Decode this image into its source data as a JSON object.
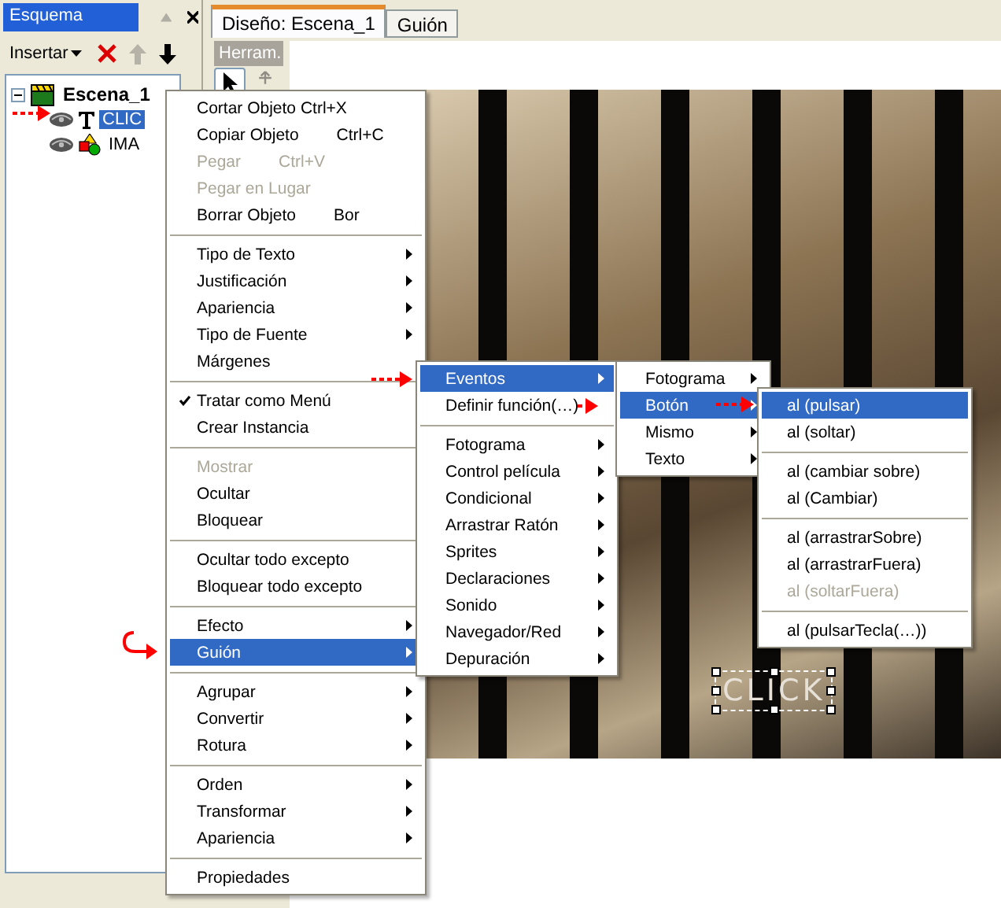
{
  "outline_panel": {
    "title": "Esquema",
    "toolbar": {
      "insert_label": "Insertar",
      "move_up_disabled": true
    },
    "tree": [
      {
        "label": "Escena_1",
        "expanded": true,
        "children": [
          {
            "label": "CLIC",
            "kind": "text",
            "selected": true
          },
          {
            "label": "IMA",
            "kind": "image",
            "selected": false
          }
        ]
      }
    ]
  },
  "tabs": [
    {
      "label": "Diseño: Escena_1",
      "selected": true
    },
    {
      "label": "Guión",
      "selected": false
    }
  ],
  "tools": {
    "label": "Herram."
  },
  "canvas": {
    "text_object": "CLICK",
    "text_selected": true
  },
  "context_menu": [
    {
      "kind": "item",
      "label": "Cortar Objeto Ctrl+X",
      "submenu": false,
      "disabled": false,
      "checked": false,
      "selected": false
    },
    {
      "kind": "item",
      "label": "Copiar Objeto",
      "shortcut": "Ctrl+C",
      "submenu": false,
      "disabled": false,
      "checked": false,
      "selected": false
    },
    {
      "kind": "item",
      "label": "Pegar",
      "shortcut": "Ctrl+V",
      "submenu": false,
      "disabled": true,
      "checked": false,
      "selected": false
    },
    {
      "kind": "item",
      "label": "Pegar en Lugar",
      "submenu": false,
      "disabled": true,
      "checked": false,
      "selected": false
    },
    {
      "kind": "item",
      "label": "Borrar Objeto",
      "shortcut": "Bor",
      "submenu": false,
      "disabled": false,
      "checked": false,
      "selected": false
    },
    {
      "kind": "separator"
    },
    {
      "kind": "item",
      "label": "Tipo de Texto",
      "submenu": true,
      "disabled": false,
      "checked": false,
      "selected": false
    },
    {
      "kind": "item",
      "label": "Justificación",
      "submenu": true,
      "disabled": false,
      "checked": false,
      "selected": false
    },
    {
      "kind": "item",
      "label": "Apariencia",
      "submenu": true,
      "disabled": false,
      "checked": false,
      "selected": false
    },
    {
      "kind": "item",
      "label": "Tipo de Fuente",
      "submenu": true,
      "disabled": false,
      "checked": false,
      "selected": false
    },
    {
      "kind": "item",
      "label": "Márgenes",
      "submenu": false,
      "disabled": false,
      "checked": false,
      "selected": false
    },
    {
      "kind": "separator"
    },
    {
      "kind": "item",
      "label": "Tratar como Menú",
      "submenu": false,
      "disabled": false,
      "checked": true,
      "selected": false
    },
    {
      "kind": "item",
      "label": "Crear Instancia",
      "submenu": false,
      "disabled": false,
      "checked": false,
      "selected": false
    },
    {
      "kind": "separator"
    },
    {
      "kind": "item",
      "label": "Mostrar",
      "submenu": false,
      "disabled": true,
      "checked": false,
      "selected": false
    },
    {
      "kind": "item",
      "label": "Ocultar",
      "submenu": false,
      "disabled": false,
      "checked": false,
      "selected": false
    },
    {
      "kind": "item",
      "label": "Bloquear",
      "submenu": false,
      "disabled": false,
      "checked": false,
      "selected": false
    },
    {
      "kind": "separator"
    },
    {
      "kind": "item",
      "label": "Ocultar todo excepto",
      "submenu": false,
      "disabled": false,
      "checked": false,
      "selected": false
    },
    {
      "kind": "item",
      "label": "Bloquear todo excepto",
      "submenu": false,
      "disabled": false,
      "checked": false,
      "selected": false
    },
    {
      "kind": "separator"
    },
    {
      "kind": "item",
      "label": "Efecto",
      "submenu": true,
      "disabled": false,
      "checked": false,
      "selected": false
    },
    {
      "kind": "item",
      "label": "Guión",
      "submenu": true,
      "disabled": false,
      "checked": false,
      "selected": true
    },
    {
      "kind": "separator"
    },
    {
      "kind": "item",
      "label": "Agrupar",
      "submenu": true,
      "disabled": false,
      "checked": false,
      "selected": false
    },
    {
      "kind": "item",
      "label": "Convertir",
      "submenu": true,
      "disabled": false,
      "checked": false,
      "selected": false
    },
    {
      "kind": "item",
      "label": "Rotura",
      "submenu": true,
      "disabled": false,
      "checked": false,
      "selected": false
    },
    {
      "kind": "separator"
    },
    {
      "kind": "item",
      "label": "Orden",
      "submenu": true,
      "disabled": false,
      "checked": false,
      "selected": false
    },
    {
      "kind": "item",
      "label": "Transformar",
      "submenu": true,
      "disabled": false,
      "checked": false,
      "selected": false
    },
    {
      "kind": "item",
      "label": "Apariencia",
      "submenu": true,
      "disabled": false,
      "checked": false,
      "selected": false
    },
    {
      "kind": "separator"
    },
    {
      "kind": "item",
      "label": "Propiedades",
      "submenu": false,
      "disabled": false,
      "checked": false,
      "selected": false
    }
  ],
  "script_submenu": [
    {
      "kind": "item",
      "label": "Eventos",
      "submenu": true,
      "disabled": false,
      "selected": true
    },
    {
      "kind": "item",
      "label": "Definir función(…)",
      "submenu": false,
      "disabled": false,
      "selected": false
    },
    {
      "kind": "separator"
    },
    {
      "kind": "item",
      "label": "Fotograma",
      "submenu": true,
      "disabled": false,
      "selected": false
    },
    {
      "kind": "item",
      "label": "Control película",
      "submenu": true,
      "disabled": false,
      "selected": false
    },
    {
      "kind": "item",
      "label": "Condicional",
      "submenu": true,
      "disabled": false,
      "selected": false
    },
    {
      "kind": "item",
      "label": "Arrastrar Ratón",
      "submenu": true,
      "disabled": false,
      "selected": false
    },
    {
      "kind": "item",
      "label": "Sprites",
      "submenu": true,
      "disabled": false,
      "selected": false
    },
    {
      "kind": "item",
      "label": "Declaraciones",
      "submenu": true,
      "disabled": false,
      "selected": false
    },
    {
      "kind": "item",
      "label": "Sonido",
      "submenu": true,
      "disabled": false,
      "selected": false
    },
    {
      "kind": "item",
      "label": "Navegador/Red",
      "submenu": true,
      "disabled": false,
      "selected": false
    },
    {
      "kind": "item",
      "label": "Depuración",
      "submenu": true,
      "disabled": false,
      "selected": false
    }
  ],
  "events_submenu": [
    {
      "kind": "item",
      "label": "Fotograma",
      "submenu": true,
      "disabled": false,
      "selected": false
    },
    {
      "kind": "item",
      "label": "Botón",
      "submenu": true,
      "disabled": false,
      "selected": true
    },
    {
      "kind": "item",
      "label": "Mismo",
      "submenu": true,
      "disabled": false,
      "selected": false
    },
    {
      "kind": "item",
      "label": "Texto",
      "submenu": true,
      "disabled": false,
      "selected": false
    }
  ],
  "button_events_submenu": [
    {
      "kind": "item",
      "label": "al (pulsar)",
      "submenu": false,
      "disabled": false,
      "selected": true
    },
    {
      "kind": "item",
      "label": "al (soltar)",
      "submenu": false,
      "disabled": false,
      "selected": false
    },
    {
      "kind": "separator"
    },
    {
      "kind": "item",
      "label": "al (cambiar sobre)",
      "submenu": false,
      "disabled": false,
      "selected": false
    },
    {
      "kind": "item",
      "label": "al (Cambiar)",
      "submenu": false,
      "disabled": false,
      "selected": false
    },
    {
      "kind": "separator"
    },
    {
      "kind": "item",
      "label": "al (arrastrarSobre)",
      "submenu": false,
      "disabled": false,
      "selected": false
    },
    {
      "kind": "item",
      "label": "al (arrastrarFuera)",
      "submenu": false,
      "disabled": false,
      "selected": false
    },
    {
      "kind": "item",
      "label": "al (soltarFuera)",
      "submenu": false,
      "disabled": true,
      "selected": false
    },
    {
      "kind": "separator"
    },
    {
      "kind": "item",
      "label": "al (pulsarTecla(…))",
      "submenu": false,
      "disabled": false,
      "selected": false
    }
  ]
}
